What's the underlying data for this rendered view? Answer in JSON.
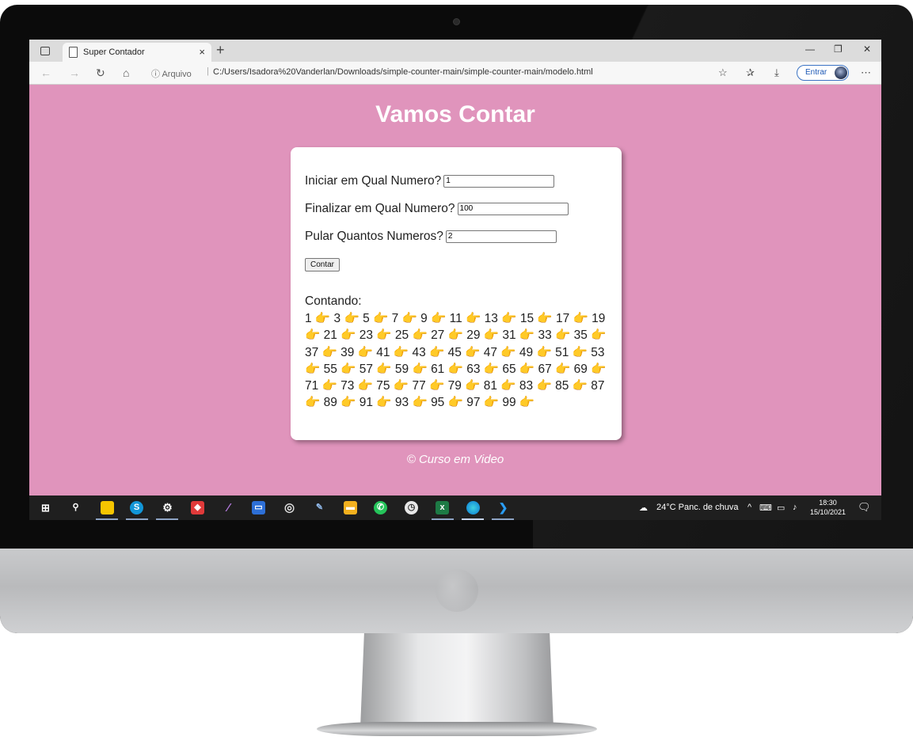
{
  "browser": {
    "tab_title": "Super Contador",
    "tab_close": "×",
    "new_tab": "+",
    "url_info": "ⓘ Arquivo",
    "url_separator": "|",
    "url": "C:/Users/Isadora%20Vanderlan/Downloads/simple-counter-main/simple-counter-main/modelo.html",
    "signin_label": "Entrar",
    "window_min": "—",
    "window_restore": "❐",
    "window_close": "✕"
  },
  "page": {
    "title": "Vamos Contar",
    "start_label": "Iniciar em Qual Numero?",
    "start_value": "1",
    "end_label": "Finalizar em Qual Numero?",
    "end_value": "100",
    "step_label": "Pular Quantos Numeros?",
    "step_value": "2",
    "count_button": "Contar",
    "result_label": "Contando:",
    "result_text": "1 👉 3 👉 5 👉 7 👉 9 👉 11 👉 13 👉 15 👉 17 👉 19 👉 21 👉 23 👉 25 👉 27 👉 29 👉 31 👉 33 👉 35 👉 37 👉 39 👉 41 👉 43 👉 45 👉 47 👉 49 👉 51 👉 53 👉 55 👉 57 👉 59 👉 61 👉 63 👉 65 👉 67 👉 69 👉 71 👉 73 👉 75 👉 77 👉 79 👉 81 👉 83 👉 85 👉 87 👉 89 👉 91 👉 93 👉 95 👉 97 👉 99 👉",
    "footer": "© Curso em Video"
  },
  "taskbar": {
    "weather": "24°C  Panc. de chuva",
    "time": "18:30",
    "date": "15/10/2021",
    "skype_letter": "S"
  },
  "colors": {
    "page_background": "#e094bc",
    "card_background": "#ffffff",
    "accent_blue": "#1b57b5"
  }
}
